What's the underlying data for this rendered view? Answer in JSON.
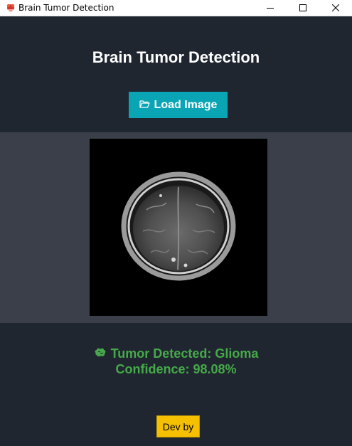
{
  "window": {
    "title": "Brain Tumor Detection",
    "app_icon": "brain-app-icon",
    "controls": [
      "minimize-icon",
      "maximize-icon",
      "close-icon"
    ]
  },
  "header": {
    "title": "Brain Tumor Detection"
  },
  "toolbar": {
    "load_label": "Load Image",
    "load_icon": "folder-open-icon"
  },
  "result": {
    "icon": "brain-icon",
    "detection_text": "Tumor Detected: Glioma",
    "confidence_text": "Confidence: 98.08%"
  },
  "footer": {
    "dev_label": "Dev by"
  },
  "colors": {
    "background": "#202630",
    "panel": "#3a3f49",
    "accent_button": "#0aa5b5",
    "result_green": "#46a94a",
    "dev_button": "#f5c000"
  }
}
